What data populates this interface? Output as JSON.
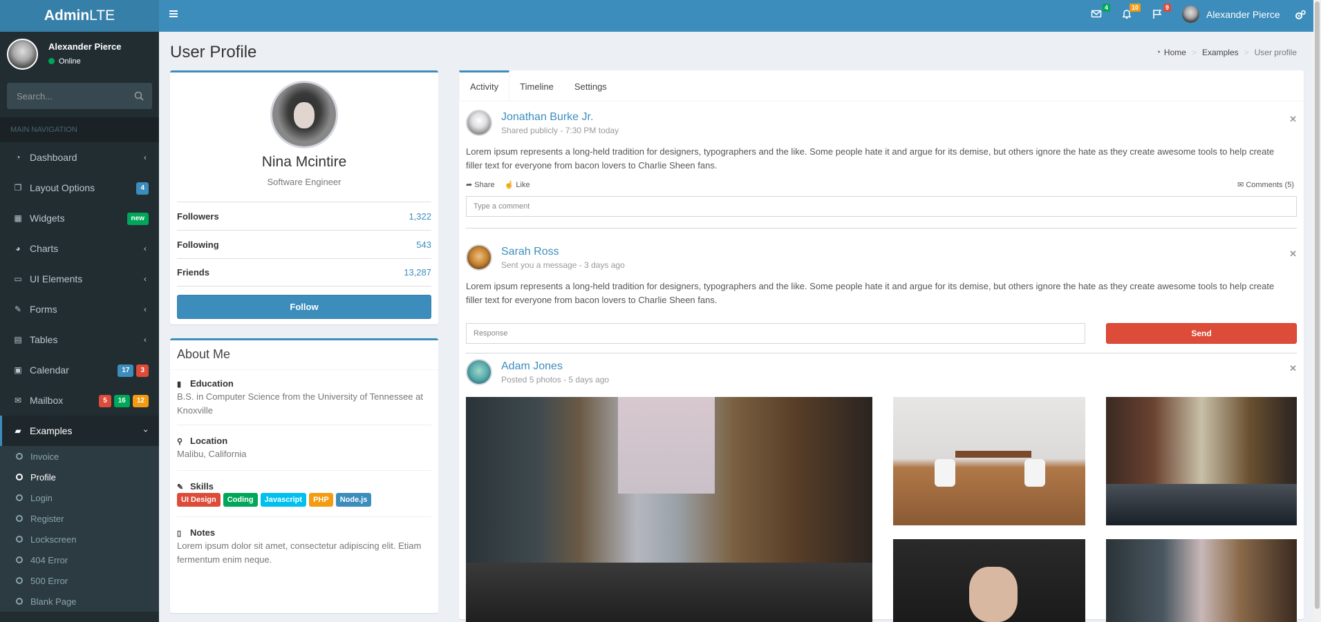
{
  "app": {
    "logo_bold": "Admin",
    "logo_rest": "LTE"
  },
  "sidebar": {
    "user_name": "Alexander Pierce",
    "user_status": "Online",
    "search_placeholder": "Search...",
    "nav_header": "MAIN NAVIGATION",
    "items": [
      {
        "label": "Dashboard",
        "icon": "dashboard-icon",
        "chevron": true
      },
      {
        "label": "Layout Options",
        "icon": "files-icon",
        "badges": [
          "4"
        ],
        "badge_colors": [
          "#3c8dbc"
        ]
      },
      {
        "label": "Widgets",
        "icon": "th-icon",
        "badges": [
          "new"
        ],
        "badge_colors": [
          "#00a65a"
        ]
      },
      {
        "label": "Charts",
        "icon": "pie-chart-icon",
        "chevron": true
      },
      {
        "label": "UI Elements",
        "icon": "laptop-icon",
        "chevron": true
      },
      {
        "label": "Forms",
        "icon": "edit-icon",
        "chevron": true
      },
      {
        "label": "Tables",
        "icon": "table-icon",
        "chevron": true
      },
      {
        "label": "Calendar",
        "icon": "calendar-icon",
        "badges": [
          "17",
          "3"
        ],
        "badge_colors": [
          "#3c8dbc",
          "#dd4b39"
        ]
      },
      {
        "label": "Mailbox",
        "icon": "envelope-icon",
        "badges": [
          "5",
          "16",
          "12"
        ],
        "badge_colors": [
          "#dd4b39",
          "#00a65a",
          "#f39c12"
        ]
      },
      {
        "label": "Examples",
        "icon": "folder-icon",
        "chevron_down": true,
        "active": true
      }
    ],
    "sub_items": [
      "Invoice",
      "Profile",
      "Login",
      "Register",
      "Lockscreen",
      "404 Error",
      "500 Error",
      "Blank Page"
    ],
    "active_sub": "Profile"
  },
  "topbar": {
    "user_name": "Alexander Pierce",
    "messages_count": "4",
    "notifications_count": "10",
    "tasks_count": "9"
  },
  "page": {
    "title": "User Profile",
    "breadcrumb": [
      "Home",
      "Examples",
      "User profile"
    ]
  },
  "profile": {
    "name": "Nina Mcintire",
    "role": "Software Engineer",
    "stats": [
      {
        "label": "Followers",
        "value": "1,322"
      },
      {
        "label": "Following",
        "value": "543"
      },
      {
        "label": "Friends",
        "value": "13,287"
      }
    ],
    "follow_label": "Follow"
  },
  "about": {
    "title": "About Me",
    "education_label": "Education",
    "education_text": "B.S. in Computer Science from the University of Tennessee at Knoxville",
    "location_label": "Location",
    "location_text": "Malibu, California",
    "skills_label": "Skills",
    "skills": [
      {
        "label": "UI Design",
        "color": "#dd4b39"
      },
      {
        "label": "Coding",
        "color": "#00a65a"
      },
      {
        "label": "Javascript",
        "color": "#00c0ef"
      },
      {
        "label": "PHP",
        "color": "#f39c12"
      },
      {
        "label": "Node.js",
        "color": "#3c8dbc"
      }
    ],
    "notes_label": "Notes",
    "notes_text": "Lorem ipsum dolor sit amet, consectetur adipiscing elit. Etiam fermentum enim neque."
  },
  "tabs": [
    "Activity",
    "Timeline",
    "Settings"
  ],
  "active_tab": "Activity",
  "posts": [
    {
      "name": "Jonathan Burke Jr.",
      "desc": "Shared publicly - 7:30 PM today",
      "text": "Lorem ipsum represents a long-held tradition for designers, typographers and the like. Some people hate it and argue for its demise, but others ignore the hate as they create awesome tools to help create filler text for everyone from bacon lovers to Charlie Sheen fans.",
      "share": "Share",
      "like": "Like",
      "comments": "Comments (5)",
      "comment_placeholder": "Type a comment"
    },
    {
      "name": "Sarah Ross",
      "desc": "Sent you a message - 3 days ago",
      "text": "Lorem ipsum represents a long-held tradition for designers, typographers and the like. Some people hate it and argue for its demise, but others ignore the hate as they create awesome tools to help create filler text for everyone from bacon lovers to Charlie Sheen fans.",
      "response_placeholder": "Response",
      "send": "Send"
    },
    {
      "name": "Adam Jones",
      "desc": "Posted 5 photos - 5 days ago"
    }
  ]
}
